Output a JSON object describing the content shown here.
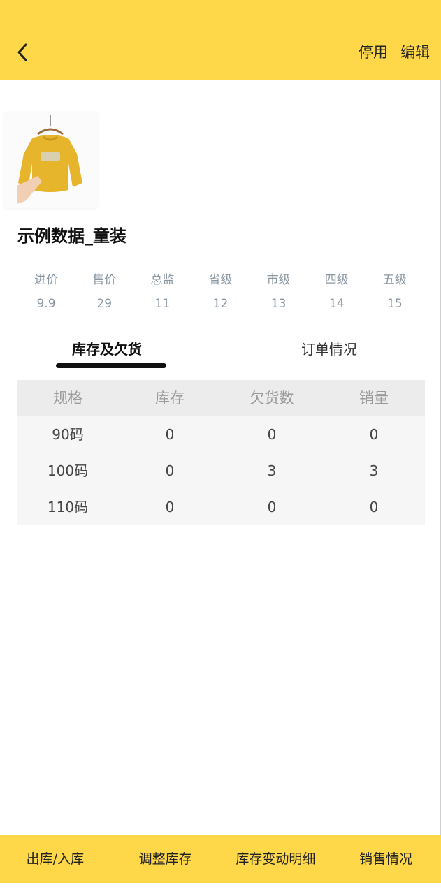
{
  "header": {
    "back_icon": "chevron-left-icon",
    "disable_label": "停用",
    "edit_label": "编辑",
    "background": "#FFD84A"
  },
  "product": {
    "image_alt": "yellow-kids-sweater",
    "title": "示例数据_童装"
  },
  "prices": [
    {
      "label": "进价",
      "value": "9.9"
    },
    {
      "label": "售价",
      "value": "29"
    },
    {
      "label": "总监",
      "value": "11"
    },
    {
      "label": "省级",
      "value": "12"
    },
    {
      "label": "市级",
      "value": "13"
    },
    {
      "label": "四级",
      "value": "14"
    },
    {
      "label": "五级",
      "value": "15"
    }
  ],
  "tabs": [
    {
      "label": "库存及欠货",
      "active": true
    },
    {
      "label": "订单情况",
      "active": false
    }
  ],
  "table": {
    "columns": [
      "规格",
      "库存",
      "欠货数",
      "销量"
    ],
    "rows": [
      [
        "90码",
        "0",
        "0",
        "0"
      ],
      [
        "100码",
        "0",
        "3",
        "3"
      ],
      [
        "110码",
        "0",
        "0",
        "0"
      ]
    ]
  },
  "bottom_bar": [
    "出库/入库",
    "调整库存",
    "库存变动明细",
    "销售情况"
  ]
}
